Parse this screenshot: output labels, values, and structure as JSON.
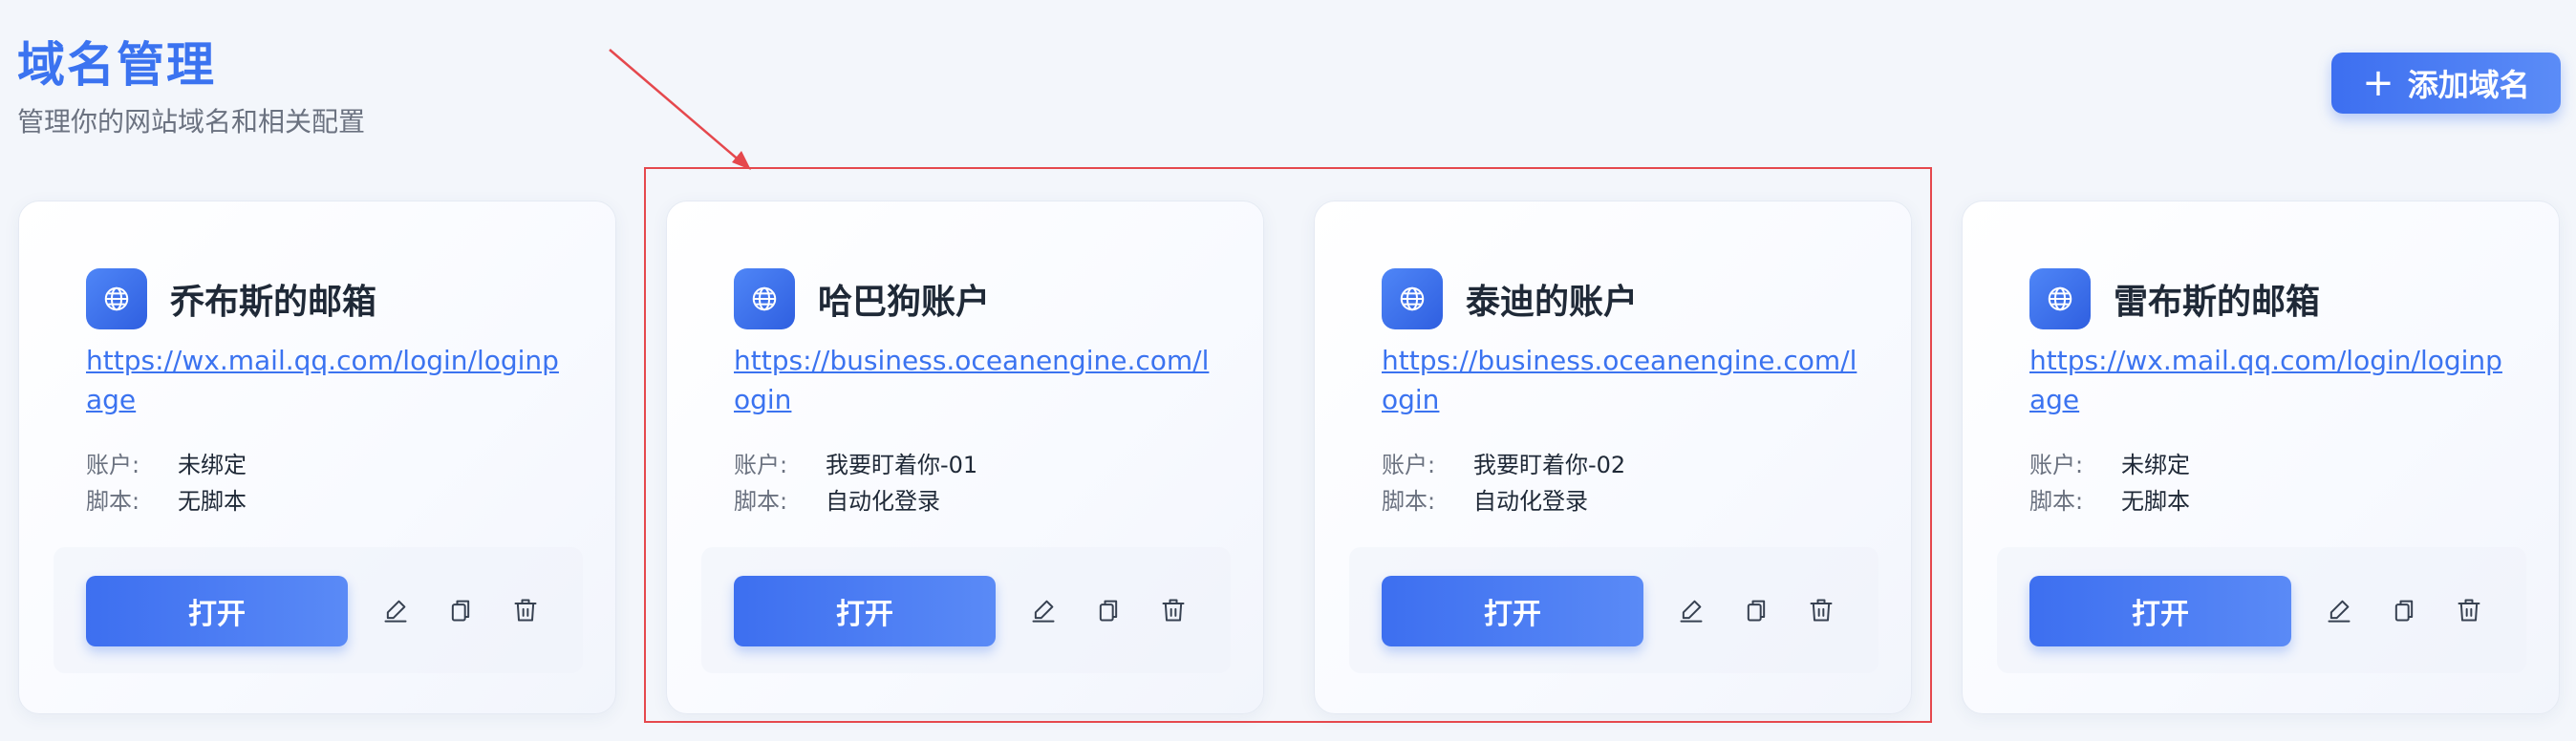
{
  "header": {
    "title": "域名管理",
    "subtitle": "管理你的网站域名和相关配置",
    "add_button": {
      "label": "添加域名",
      "icon": "plus-icon"
    }
  },
  "labels": {
    "account": "账户:",
    "script": "脚本:"
  },
  "cards": [
    {
      "name": "乔布斯的邮箱",
      "url": "https://wx.mail.qq.com/login/loginpage",
      "account": "未绑定",
      "script": "无脚本",
      "open_label": "打开"
    },
    {
      "name": "哈巴狗账户",
      "url": "https://business.oceanengine.com/login",
      "account": "我要盯着你-01",
      "script": "自动化登录",
      "open_label": "打开"
    },
    {
      "name": "泰迪的账户",
      "url": "https://business.oceanengine.com/login",
      "account": "我要盯着你-02",
      "script": "自动化登录",
      "open_label": "打开"
    },
    {
      "name": "雷布斯的邮箱",
      "url": "https://wx.mail.qq.com/login/loginpage",
      "account": "未绑定",
      "script": "无脚本",
      "open_label": "打开"
    }
  ],
  "icons": {
    "card_icon": "globe-icon",
    "edit": "edit-icon",
    "copy": "copy-icon",
    "delete": "trash-icon",
    "annotation": "red-arrow-annotation"
  },
  "colors": {
    "accent": "#3b73f0",
    "annotation": "#e5484d",
    "background": "#f3f6fb"
  }
}
